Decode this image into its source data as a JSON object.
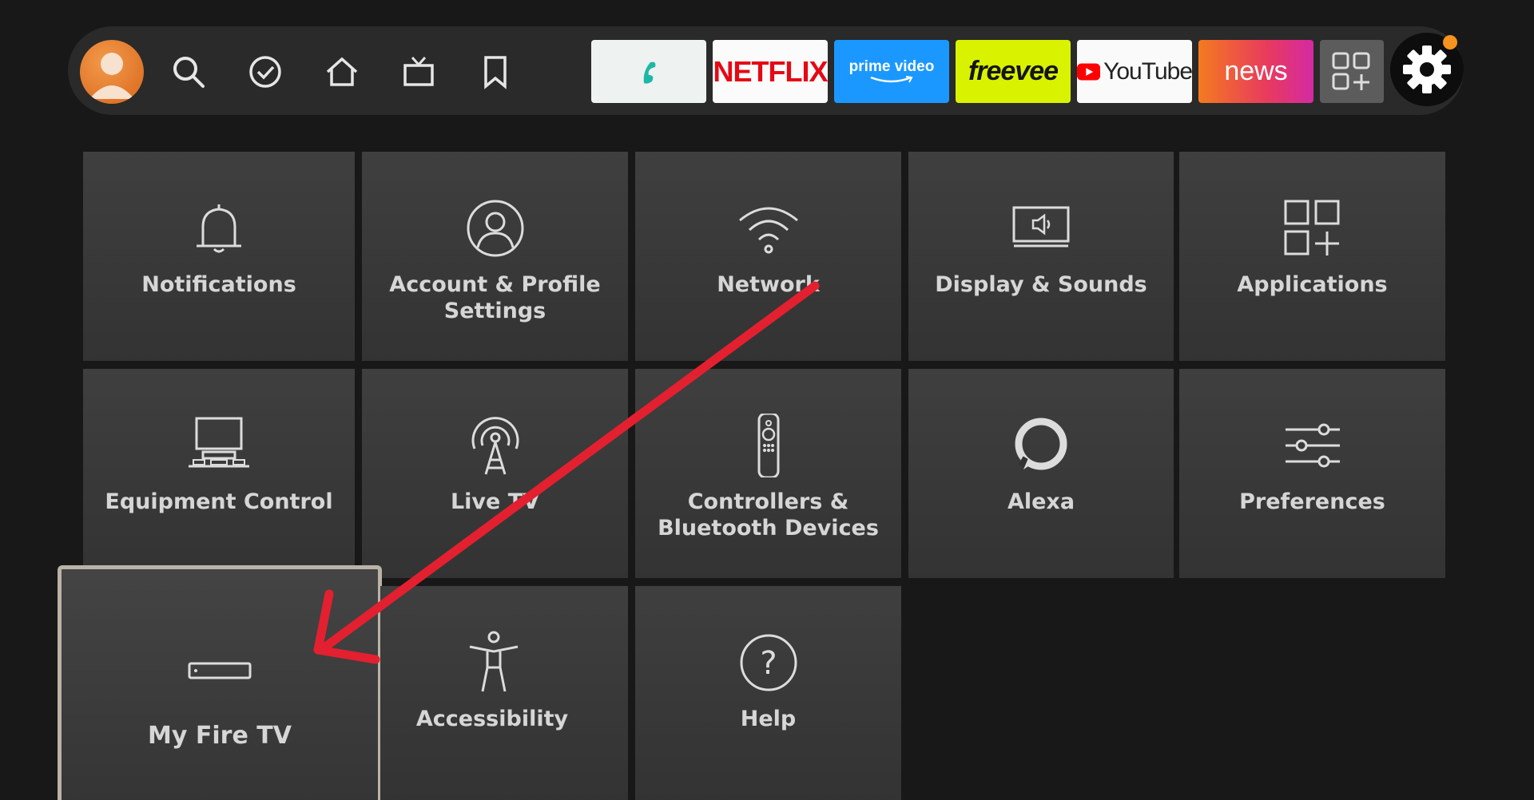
{
  "navbar": {
    "icons": [
      "profile-avatar",
      "search-icon",
      "check-circle-icon",
      "home-icon",
      "live-tv-icon",
      "bookmark-icon"
    ],
    "apps": [
      {
        "name": "surfshark",
        "label": ""
      },
      {
        "name": "netflix",
        "label": "NETFLIX"
      },
      {
        "name": "prime-video",
        "label": "prime video"
      },
      {
        "name": "freevee",
        "label": "freevee"
      },
      {
        "name": "youtube",
        "label": "YouTube"
      },
      {
        "name": "news",
        "label": "news"
      }
    ],
    "app_library_icon": "app-grid-plus-icon",
    "settings_icon": "gear-icon",
    "colors": {
      "accent": "#f7931e",
      "netflix": "#e50914",
      "prime": "#1a98ff",
      "freevee": "#d9f200",
      "youtube": "#ff0000"
    }
  },
  "settings": {
    "tiles": [
      {
        "id": "notifications",
        "icon": "bell-icon",
        "label": "Notifications"
      },
      {
        "id": "account-profile",
        "icon": "user-circle-icon",
        "label": "Account & Profile Settings"
      },
      {
        "id": "network",
        "icon": "wifi-icon",
        "label": "Network"
      },
      {
        "id": "display-sounds",
        "icon": "monitor-speaker-icon",
        "label": "Display & Sounds"
      },
      {
        "id": "applications",
        "icon": "apps-grid-icon",
        "label": "Applications"
      },
      {
        "id": "equipment-control",
        "icon": "equipment-icon",
        "label": "Equipment Control"
      },
      {
        "id": "live-tv",
        "icon": "antenna-icon",
        "label": "Live TV"
      },
      {
        "id": "controllers-bluetooth",
        "icon": "remote-icon",
        "label": "Controllers & Bluetooth Devices"
      },
      {
        "id": "alexa",
        "icon": "alexa-ring-icon",
        "label": "Alexa"
      },
      {
        "id": "preferences",
        "icon": "sliders-icon",
        "label": "Preferences"
      },
      {
        "id": "my-fire-tv",
        "icon": "fire-tv-device-icon",
        "label": "My Fire TV"
      },
      {
        "id": "accessibility",
        "icon": "accessibility-icon",
        "label": "Accessibility"
      },
      {
        "id": "help",
        "icon": "question-circle-icon",
        "label": "Help"
      }
    ],
    "focused": "My Fire TV"
  },
  "annotation": {
    "type": "arrow",
    "color": "#e3202f"
  }
}
